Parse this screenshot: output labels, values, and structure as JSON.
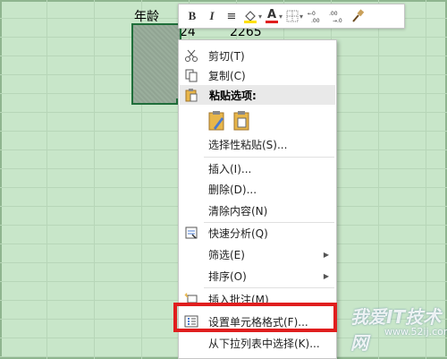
{
  "sheet": {
    "header_cell": "年龄",
    "cell_age": "24",
    "cell_value": "2265"
  },
  "toolbar": {
    "bold": "B",
    "italic": "I",
    "align": "≡",
    "font_color": "A"
  },
  "menu": {
    "cut": "剪切(T)",
    "copy": "复制(C)",
    "paste_options": "粘贴选项:",
    "paste_special": "选择性粘贴(S)...",
    "insert": "插入(I)...",
    "delete": "删除(D)...",
    "clear": "清除内容(N)",
    "quick_analysis": "快速分析(Q)",
    "filter": "筛选(E)",
    "sort": "排序(O)",
    "insert_comment": "插入批注(M)",
    "format_cells": "设置单元格格式(F)...",
    "pick_list": "从下拉列表中选择(K)..."
  },
  "watermark": {
    "text": "我爱IT技术网",
    "url": "www.52ij.com"
  },
  "colors": {
    "highlight": "#e01e1e",
    "sheet_bg": "#c8e6c9",
    "selection_border": "#1f6e3a"
  }
}
